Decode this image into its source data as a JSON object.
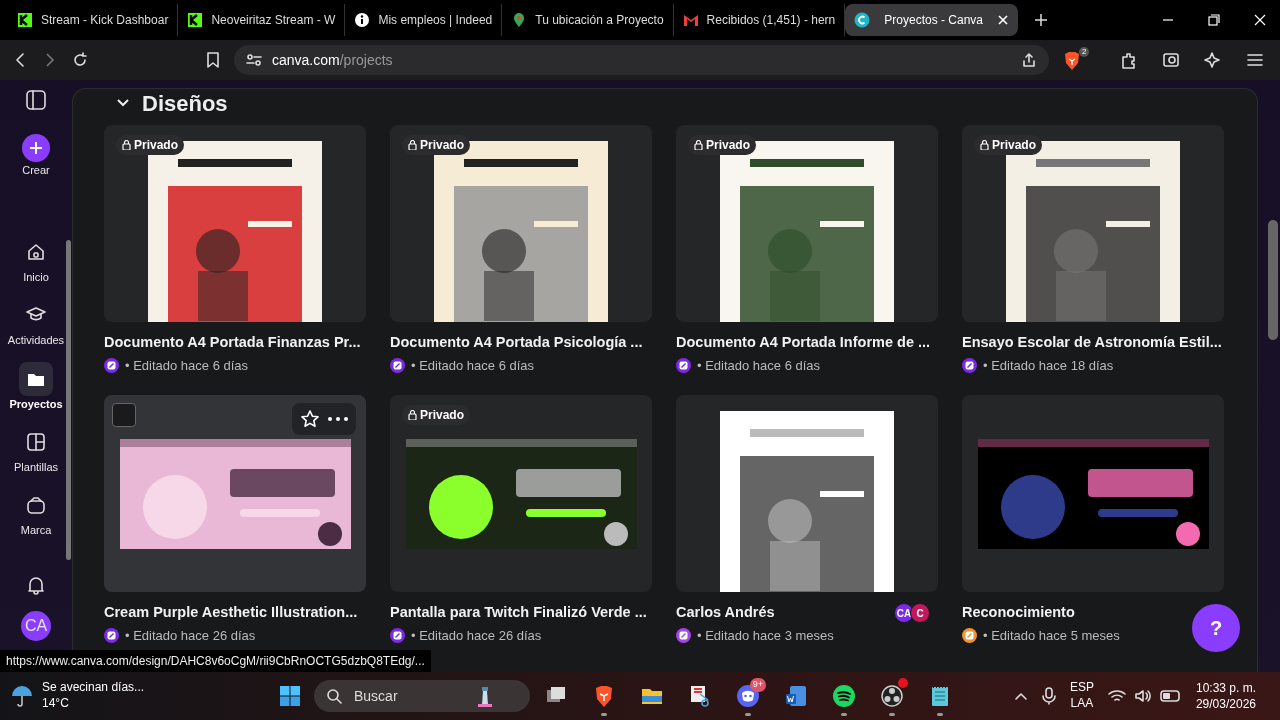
{
  "browser": {
    "tabs": [
      {
        "title": "Stream - Kick Dashboar",
        "kind": "kick",
        "selected": false
      },
      {
        "title": "Neoveiritaz Stream - W",
        "kind": "kick",
        "selected": false
      },
      {
        "title": "Mis empleos | Indeed",
        "kind": "info",
        "selected": false
      },
      {
        "title": "Tu ubicación a Proyecto",
        "kind": "pin",
        "selected": false
      },
      {
        "title": "Recibidos (1,451) - hern",
        "kind": "mail",
        "selected": false
      },
      {
        "title": "Proyectos - Canva",
        "kind": "canva",
        "selected": true
      }
    ],
    "address": {
      "host": "canva.com",
      "path": "/projects"
    },
    "extension_badge": "2"
  },
  "sidebar": {
    "create": "Crear",
    "items": [
      {
        "label": "Inicio",
        "kind": "home",
        "selected": false
      },
      {
        "label": "Actividades",
        "kind": "cap",
        "selected": false
      },
      {
        "label": "Proyectos",
        "kind": "folder",
        "selected": true
      },
      {
        "label": "Plantillas",
        "kind": "layout",
        "selected": false
      },
      {
        "label": "Marca",
        "kind": "brand",
        "selected": false
      }
    ],
    "avatar": "CA"
  },
  "section": {
    "title": "Diseños",
    "expanded": true
  },
  "designs": [
    {
      "title": "Documento A4 Portada Finanzas Pr...",
      "meta": "• Editado hace 6 días",
      "private": "Privado",
      "kind": "document",
      "hovered": false,
      "color": "#7d2ae8"
    },
    {
      "title": "Documento A4 Portada Psicología ...",
      "meta": "• Editado hace 6 días",
      "private": "Privado",
      "kind": "document",
      "hovered": false,
      "color": "#7d2ae8"
    },
    {
      "title": "Documento A4 Portada Informe de ...",
      "meta": "• Editado hace 6 días",
      "private": "Privado",
      "kind": "document",
      "hovered": false,
      "color": "#7d2ae8"
    },
    {
      "title": "Ensayo Escolar de Astronomía Estil...",
      "meta": "• Editado hace 18 días",
      "private": "Privado",
      "kind": "document",
      "hovered": false,
      "color": "#7d2ae8"
    },
    {
      "title": "Cream Purple Aesthetic Illustration...",
      "meta": "• Editado hace 26 días",
      "kind": "banner",
      "hovered": true,
      "color": "#7d2ae8"
    },
    {
      "title": "Pantalla para Twitch Finalizó Verde ...",
      "meta": "• Editado hace 26 días",
      "private": "Privado",
      "kind": "banner",
      "hovered": false,
      "color": "#7d2ae8"
    },
    {
      "title": "Carlos Andrés",
      "meta": "• Editado hace 3 meses",
      "kind": "document",
      "hovered": false,
      "color": "#a445e6",
      "avatars": [
        {
          "text": "CA",
          "color": "#7d2ae8"
        },
        {
          "text": "C",
          "color": "#c2185b"
        }
      ]
    },
    {
      "title": "Reconocimiento",
      "meta": "• Editado hace 5 meses",
      "kind": "banner",
      "hovered": false,
      "color": "#f0932b"
    }
  ],
  "help": "?",
  "status_url": "https://www.canva.com/design/DAHC8v6oCgM/rii9CbRnOCTG5dzbQ8TEdg/...",
  "taskbar": {
    "weather": {
      "title": "Se avecinan días...",
      "temp": "14°C"
    },
    "search": {
      "placeholder": "Buscar"
    },
    "apps": [
      {
        "kind": "taskview",
        "running": false
      },
      {
        "kind": "brave",
        "running": true
      },
      {
        "kind": "files",
        "running": false
      },
      {
        "kind": "snip",
        "running": false
      },
      {
        "kind": "discord",
        "running": true,
        "badge": "9+"
      },
      {
        "kind": "word",
        "running": false
      },
      {
        "kind": "spotify",
        "running": true
      },
      {
        "kind": "obs",
        "running": true,
        "alert": true
      },
      {
        "kind": "notepad",
        "running": true
      }
    ],
    "lang": [
      "ESP",
      "LAA"
    ],
    "time": "10:33 p. m.",
    "date": "29/03/2026"
  }
}
